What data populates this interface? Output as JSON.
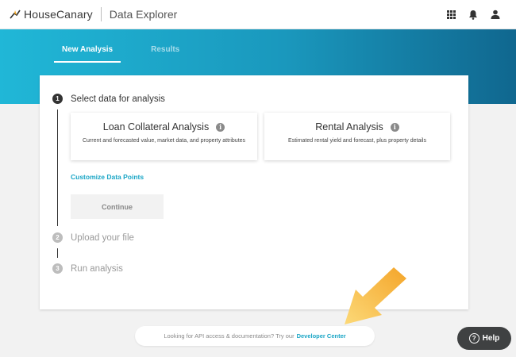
{
  "header": {
    "brand": "HouseCanary",
    "product": "Data Explorer",
    "icons": [
      "apps-grid-icon",
      "bell-icon",
      "user-icon"
    ]
  },
  "tabs": [
    {
      "label": "New Analysis",
      "active": true
    },
    {
      "label": "Results",
      "active": false
    }
  ],
  "steps": [
    {
      "number": "1",
      "title": "Select data for analysis",
      "active": true
    },
    {
      "number": "2",
      "title": "Upload your file",
      "active": false
    },
    {
      "number": "3",
      "title": "Run analysis",
      "active": false
    }
  ],
  "options": [
    {
      "title": "Loan Collateral Analysis",
      "description": "Current and forecasted value, market data, and property attributes"
    },
    {
      "title": "Rental Analysis",
      "description": "Estimated rental yield and forecast, plus property details"
    }
  ],
  "customize_label": "Customize Data Points",
  "continue_label": "Continue",
  "footer": {
    "text": "Looking for API access & documentation? Try our",
    "link": "Developer Center"
  },
  "help_label": "Help",
  "colors": {
    "accent": "#1aa6c6",
    "arrow": "#f7b733",
    "gradient_start": "#20b7d7",
    "gradient_end": "#10678f"
  }
}
